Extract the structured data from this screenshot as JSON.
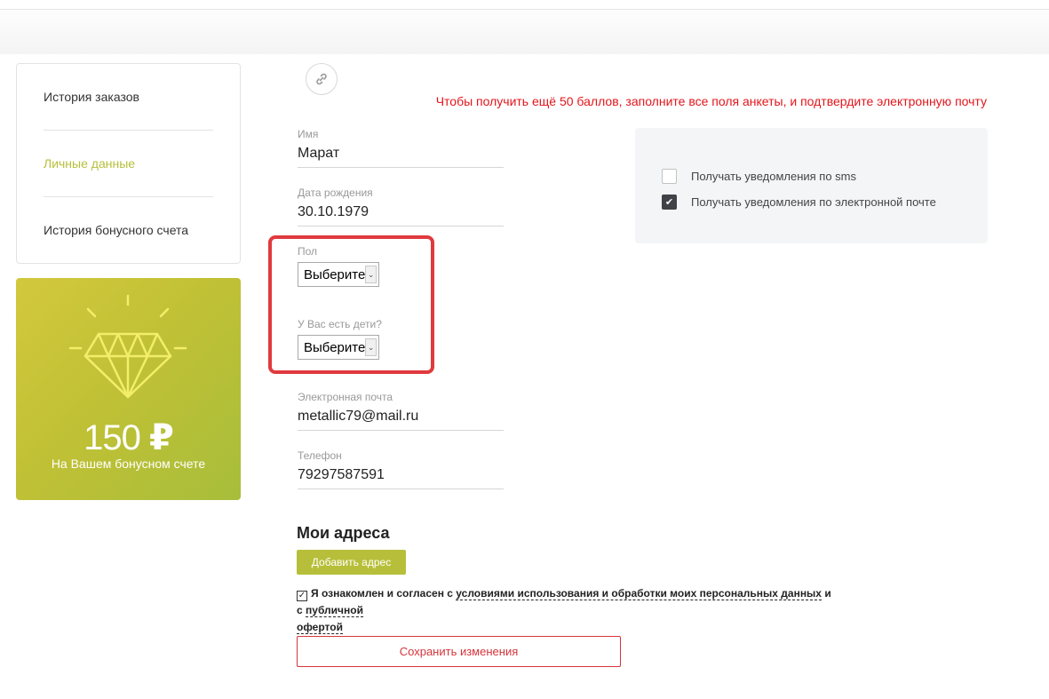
{
  "sidebar": {
    "items": [
      {
        "label": "История заказов",
        "active": false
      },
      {
        "label": "Личные данные",
        "active": true
      },
      {
        "label": "История бонусного счета",
        "active": false
      }
    ]
  },
  "bonus": {
    "amount": "150",
    "currency": "₽",
    "caption": "На Вашем бонусном счете",
    "icon": "diamond-icon"
  },
  "promo_text": "Чтобы получить ещё 50 баллов, заполните все поля анкеты, и подтвердите электронную почту",
  "form": {
    "name": {
      "label": "Имя",
      "value": "Марат"
    },
    "birthdate": {
      "label": "Дата рождения",
      "value": "30.10.1979"
    },
    "gender": {
      "label": "Пол",
      "selected": "Выберите"
    },
    "children": {
      "label": "У Вас есть дети?",
      "selected": "Выберите"
    },
    "email": {
      "label": "Электронная почта",
      "value": "metallic79@mail.ru"
    },
    "phone": {
      "label": "Телефон",
      "value": "79297587591"
    }
  },
  "notifications": {
    "sms": {
      "label": "Получать уведомления по sms",
      "checked": false
    },
    "email": {
      "label": "Получать уведомления по электронной почте",
      "checked": true
    }
  },
  "addresses": {
    "title": "Мои адреса",
    "add_button": "Добавить адрес"
  },
  "agreement": {
    "checked": true,
    "text_before": "Я ознакомлен и согласен с ",
    "link1": "условиями использования и обработки моих персональных данных",
    "text_middle": " и с ",
    "link2_part1": "публичной",
    "link2_part2": "офертой"
  },
  "save_button": "Сохранить изменения",
  "colors": {
    "accent": "#b7bf3a",
    "promo": "#e3151b",
    "highlight": "#e03a3e",
    "save": "#d5353b"
  }
}
